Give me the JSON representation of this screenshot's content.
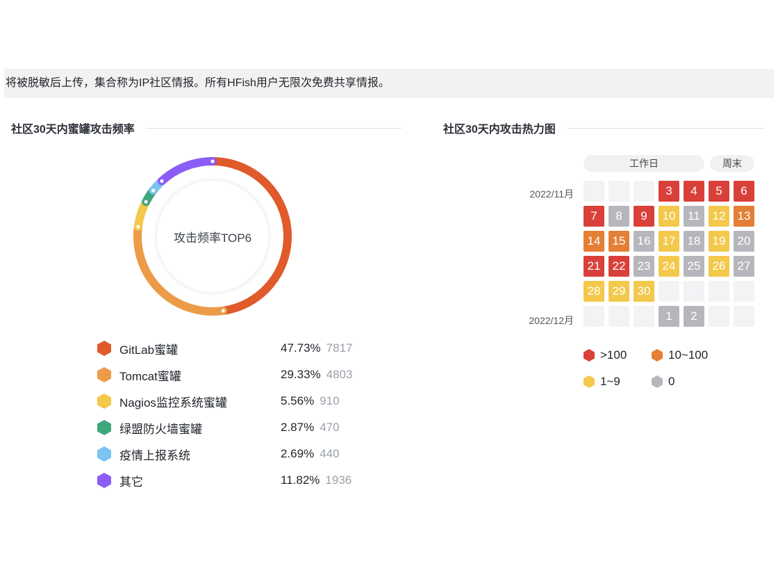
{
  "notice_text": "将被脱敏后上传，集合称为IP社区情报。所有HFish用户无限次免费共享情报。",
  "left_panel": {
    "title": "社区30天内蜜罐攻击频率",
    "donut_center": "攻击频率TOP6"
  },
  "chart_data": {
    "type": "pie",
    "title": "攻击频率TOP6",
    "categories": [
      "GitLab蜜罐",
      "Tomcat蜜罐",
      "Nagios监控系统蜜罐",
      "绿盟防火墙蜜罐",
      "疫情上报系统",
      "其它"
    ],
    "values": [
      7817,
      4803,
      910,
      470,
      440,
      1936
    ],
    "percents": [
      "47.73%",
      "29.33%",
      "5.56%",
      "2.87%",
      "2.69%",
      "11.82%"
    ],
    "colors": [
      "#e05a2b",
      "#ec9b49",
      "#f3c84b",
      "#3fa77b",
      "#7cc3f2",
      "#8b5cf6"
    ]
  },
  "right_panel": {
    "title": "社区30天内攻击热力图",
    "header_workday": "工作日",
    "header_weekend": "周末",
    "months": [
      "2022/11月",
      "2022/12月"
    ],
    "calendar": [
      [
        null,
        null,
        null,
        {
          "d": "3",
          "lvl": 0
        },
        {
          "d": "4",
          "lvl": 0
        },
        {
          "d": "5",
          "lvl": 0
        },
        {
          "d": "6",
          "lvl": 0
        }
      ],
      [
        {
          "d": "7",
          "lvl": 0
        },
        {
          "d": "8",
          "lvl": 3
        },
        {
          "d": "9",
          "lvl": 0
        },
        {
          "d": "10",
          "lvl": 2
        },
        {
          "d": "11",
          "lvl": 3
        },
        {
          "d": "12",
          "lvl": 2
        },
        {
          "d": "13",
          "lvl": 1
        }
      ],
      [
        {
          "d": "14",
          "lvl": 1
        },
        {
          "d": "15",
          "lvl": 1
        },
        {
          "d": "16",
          "lvl": 3
        },
        {
          "d": "17",
          "lvl": 2
        },
        {
          "d": "18",
          "lvl": 3
        },
        {
          "d": "19",
          "lvl": 2
        },
        {
          "d": "20",
          "lvl": 3
        }
      ],
      [
        {
          "d": "21",
          "lvl": 0
        },
        {
          "d": "22",
          "lvl": 0
        },
        {
          "d": "23",
          "lvl": 3
        },
        {
          "d": "24",
          "lvl": 2
        },
        {
          "d": "25",
          "lvl": 3
        },
        {
          "d": "26",
          "lvl": 2
        },
        {
          "d": "27",
          "lvl": 3
        }
      ],
      [
        {
          "d": "28",
          "lvl": 2
        },
        {
          "d": "29",
          "lvl": 2
        },
        {
          "d": "30",
          "lvl": 2
        },
        null,
        null,
        null,
        null
      ],
      [
        null,
        null,
        null,
        {
          "d": "1",
          "lvl": 3
        },
        {
          "d": "2",
          "lvl": 3
        },
        null,
        null
      ]
    ],
    "levels": [
      {
        "label": ">100",
        "color": "#d9403a"
      },
      {
        "label": "10~100",
        "color": "#e47f35"
      },
      {
        "label": "1~9",
        "color": "#f3c84b"
      },
      {
        "label": "0",
        "color": "#b6b7bd"
      }
    ],
    "empty_color": "#f2f3f5"
  }
}
